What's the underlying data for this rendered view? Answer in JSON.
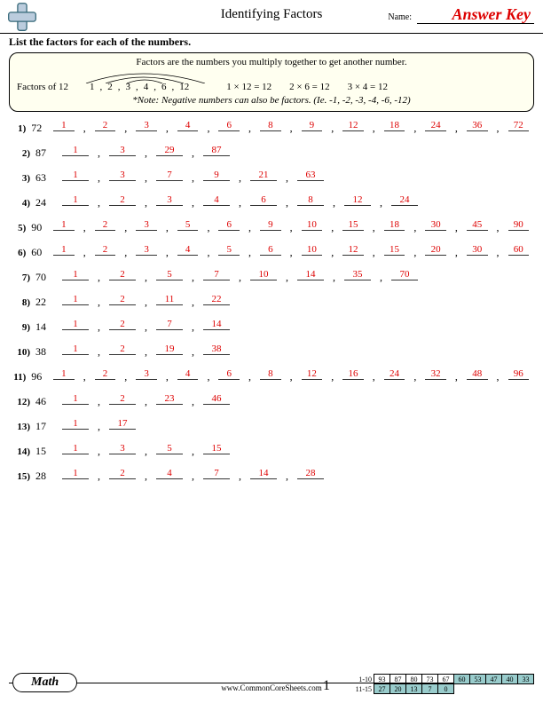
{
  "header": {
    "title": "Identifying Factors",
    "name_label": "Name:",
    "answer_key": "Answer Key"
  },
  "instructions": "List the factors for each of the numbers.",
  "example": {
    "head": "Factors are the numbers you multiply together to get another number.",
    "label": "Factors of 12",
    "factors": [
      "1",
      "2",
      "3",
      "4",
      "6",
      "12"
    ],
    "products": [
      "1 × 12 = 12",
      "2 × 6 = 12",
      "3 × 4 = 12"
    ],
    "note": "*Note: Negative numbers can also be factors. (Ie. -1, -2, -3, -4, -6, -12)"
  },
  "problems": [
    {
      "n": "72",
      "factors": [
        "1",
        "2",
        "3",
        "4",
        "6",
        "8",
        "9",
        "12",
        "18",
        "24",
        "36",
        "72"
      ]
    },
    {
      "n": "87",
      "factors": [
        "1",
        "3",
        "29",
        "87"
      ]
    },
    {
      "n": "63",
      "factors": [
        "1",
        "3",
        "7",
        "9",
        "21",
        "63"
      ]
    },
    {
      "n": "24",
      "factors": [
        "1",
        "2",
        "3",
        "4",
        "6",
        "8",
        "12",
        "24"
      ]
    },
    {
      "n": "90",
      "factors": [
        "1",
        "2",
        "3",
        "5",
        "6",
        "9",
        "10",
        "15",
        "18",
        "30",
        "45",
        "90"
      ]
    },
    {
      "n": "60",
      "factors": [
        "1",
        "2",
        "3",
        "4",
        "5",
        "6",
        "10",
        "12",
        "15",
        "20",
        "30",
        "60"
      ]
    },
    {
      "n": "70",
      "factors": [
        "1",
        "2",
        "5",
        "7",
        "10",
        "14",
        "35",
        "70"
      ]
    },
    {
      "n": "22",
      "factors": [
        "1",
        "2",
        "11",
        "22"
      ]
    },
    {
      "n": "14",
      "factors": [
        "1",
        "2",
        "7",
        "14"
      ]
    },
    {
      "n": "38",
      "factors": [
        "1",
        "2",
        "19",
        "38"
      ]
    },
    {
      "n": "96",
      "factors": [
        "1",
        "2",
        "3",
        "4",
        "6",
        "8",
        "12",
        "16",
        "24",
        "32",
        "48",
        "96"
      ]
    },
    {
      "n": "46",
      "factors": [
        "1",
        "2",
        "23",
        "46"
      ]
    },
    {
      "n": "17",
      "factors": [
        "1",
        "17"
      ]
    },
    {
      "n": "15",
      "factors": [
        "1",
        "3",
        "5",
        "15"
      ]
    },
    {
      "n": "28",
      "factors": [
        "1",
        "2",
        "4",
        "7",
        "14",
        "28"
      ]
    }
  ],
  "footer": {
    "subject": "Math",
    "site": "www.CommonCoreSheets.com",
    "page": "1",
    "score_labels": [
      "1-10",
      "11-15"
    ],
    "score_rows": [
      [
        "93",
        "87",
        "80",
        "73",
        "67",
        "60",
        "53",
        "47",
        "40",
        "33"
      ],
      [
        "27",
        "20",
        "13",
        "7",
        "0"
      ]
    ],
    "shade_from": [
      5,
      0
    ]
  }
}
